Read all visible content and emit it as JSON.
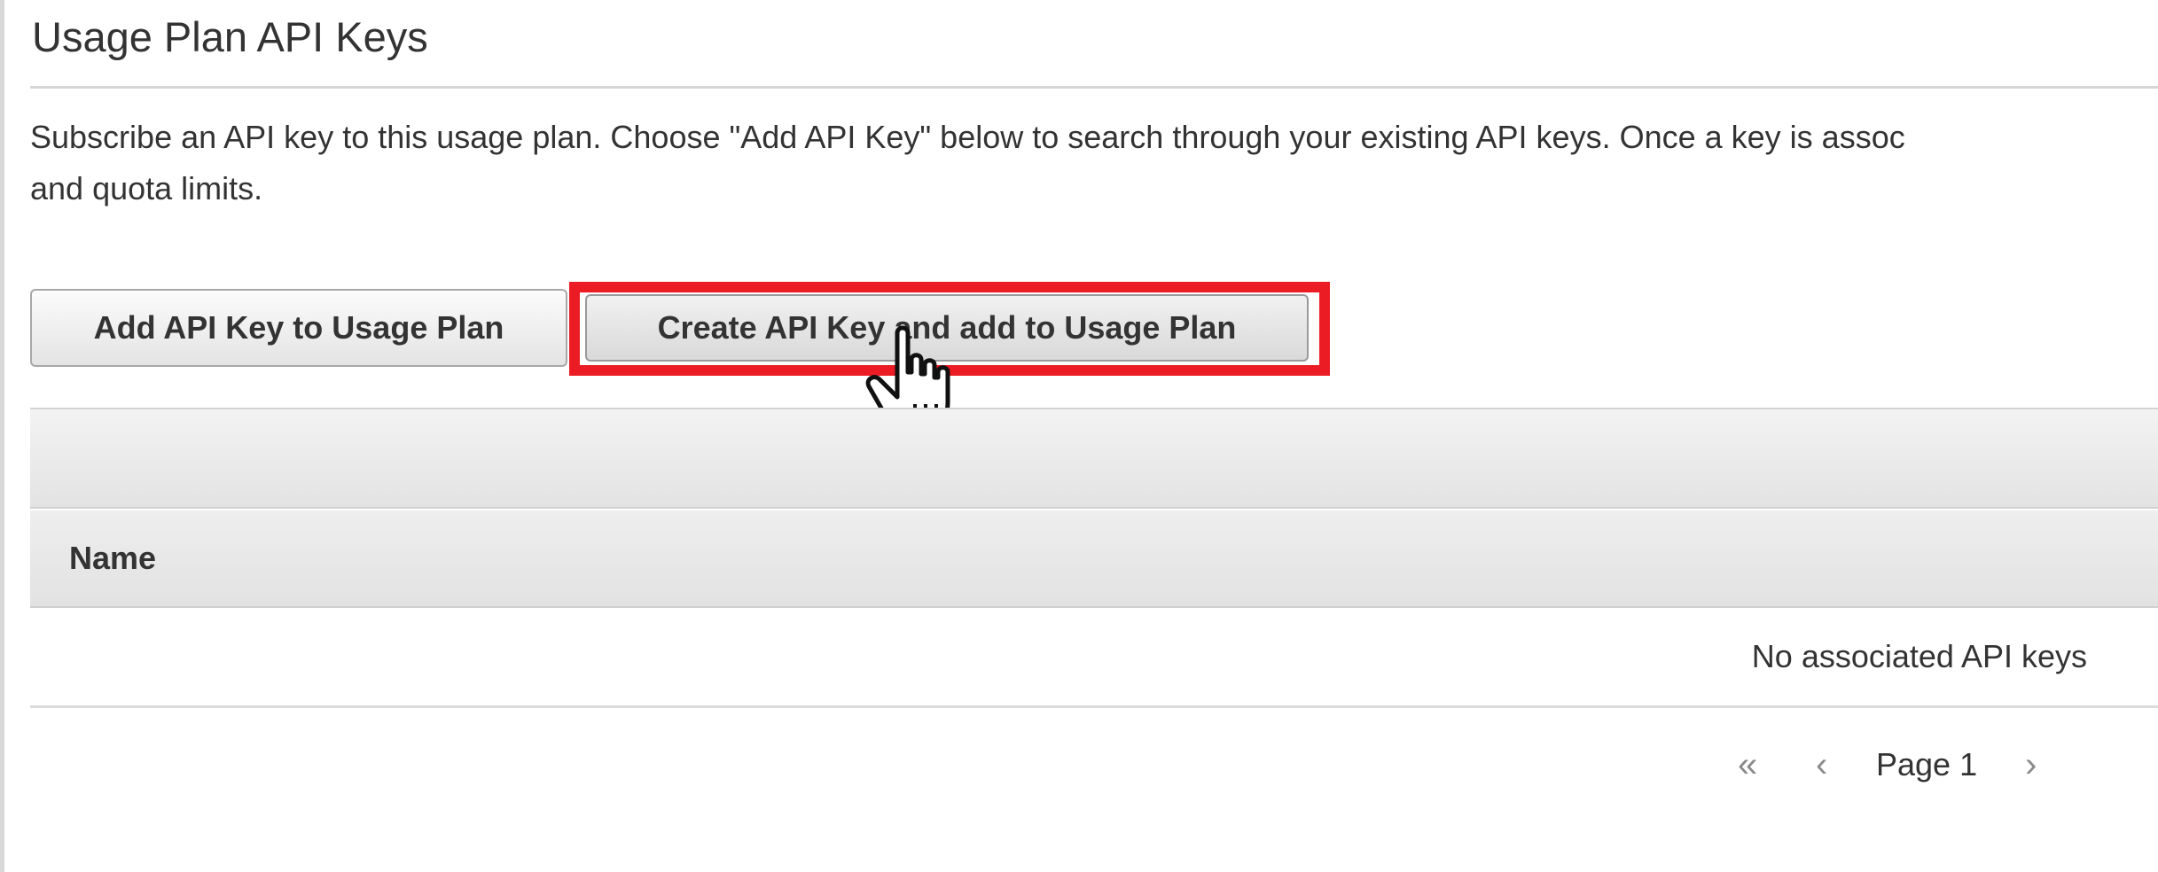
{
  "section": {
    "title": "Usage Plan API Keys",
    "description_line1": "Subscribe an API key to this usage plan. Choose \"Add API Key\" below to search through your existing API keys. Once a key is assoc",
    "description_line2": "and quota limits."
  },
  "actions": {
    "add_label": "Add API Key to Usage Plan",
    "create_label": "Create API Key and add to Usage Plan"
  },
  "annotation": {
    "highlight_color": "#ec1c24"
  },
  "table": {
    "columns": [
      "Name"
    ],
    "empty_message": "No associated API keys"
  },
  "pagination": {
    "first_icon": "double-chevron-left-icon",
    "prev_icon": "chevron-left-icon",
    "next_icon": "chevron-right-icon",
    "first_glyph": "«",
    "prev_glyph": "‹",
    "next_glyph": "›",
    "page_label": "Page 1"
  }
}
